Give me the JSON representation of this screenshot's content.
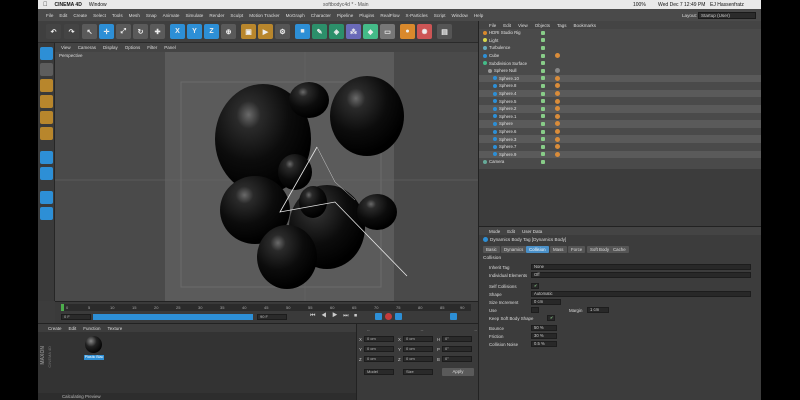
{
  "mac_menubar": {
    "apple": "",
    "app": "CINEMA 4D",
    "window": "Window",
    "clock": "Wed Dec 7  12:49 PM",
    "user": "EJ Hassenfratz",
    "battery": "100%"
  },
  "window_title": "softbodyc4d * - Main",
  "layout": {
    "label": "Layout:",
    "value": "Startup (User)"
  },
  "menu": [
    "File",
    "Edit",
    "Create",
    "Select",
    "Tools",
    "Mesh",
    "Snap",
    "Animate",
    "Simulate",
    "Render",
    "Sculpt",
    "Motion Tracker",
    "MoGraph",
    "Character",
    "Pipeline",
    "Plugins",
    "RealFlow",
    "X-Particles",
    "Script",
    "Window",
    "Help"
  ],
  "toolbar": {
    "axes": [
      "X",
      "Y",
      "Z"
    ]
  },
  "viewport": {
    "menus": [
      "View",
      "Cameras",
      "Display",
      "Options",
      "Filter",
      "Panel"
    ],
    "label": "Perspective"
  },
  "timeline": {
    "ticks": [
      "0",
      "5",
      "10",
      "15",
      "20",
      "25",
      "30",
      "35",
      "40",
      "45",
      "50",
      "55",
      "60",
      "65",
      "70",
      "75",
      "80",
      "85",
      "90"
    ],
    "current": "0 F",
    "start": "0 F",
    "end": "90 F",
    "max": "90 F"
  },
  "material_manager": {
    "menus": [
      "Create",
      "Edit",
      "Function",
      "Texture"
    ],
    "material_name": "Plastic Blac",
    "status": "Calculating Preview",
    "brand_line1": "MAXON",
    "brand_line2": "CINEMA 4D"
  },
  "coordinates": {
    "headers": [
      "--",
      "--",
      "--"
    ],
    "rows": [
      {
        "axis": "X",
        "pos": "0 cm",
        "axis2": "X",
        "size": "0 cm",
        "axis3": "H",
        "rot": "0°"
      },
      {
        "axis": "Y",
        "pos": "0 cm",
        "axis2": "Y",
        "size": "0 cm",
        "axis3": "P",
        "rot": "0°"
      },
      {
        "axis": "Z",
        "pos": "0 cm",
        "axis2": "Z",
        "size": "0 cm",
        "axis3": "B",
        "rot": "0°"
      }
    ],
    "mode1": "Model",
    "mode2": "Size",
    "apply": "Apply"
  },
  "object_manager": {
    "menus": [
      "File",
      "Edit",
      "View",
      "Objects",
      "Tags",
      "Bookmarks"
    ],
    "objects": [
      {
        "name": "HDRI Studio Rig",
        "indent": 0
      },
      {
        "name": "Light",
        "indent": 0
      },
      {
        "name": "Turbulence",
        "indent": 0
      },
      {
        "name": "Cube",
        "indent": 0
      },
      {
        "name": "Subdivision Surface",
        "indent": 0
      },
      {
        "name": "Sphere Null",
        "indent": 1
      },
      {
        "name": "Sphere.10",
        "indent": 2
      },
      {
        "name": "Sphere.8",
        "indent": 2
      },
      {
        "name": "Sphere.4",
        "indent": 2
      },
      {
        "name": "Sphere.5",
        "indent": 2
      },
      {
        "name": "Sphere.2",
        "indent": 2
      },
      {
        "name": "Sphere.1",
        "indent": 2
      },
      {
        "name": "Sphere",
        "indent": 2
      },
      {
        "name": "Sphere.6",
        "indent": 2
      },
      {
        "name": "Sphere.3",
        "indent": 2
      },
      {
        "name": "Sphere.7",
        "indent": 2
      },
      {
        "name": "Sphere.9",
        "indent": 2
      },
      {
        "name": "Camera",
        "indent": 0
      }
    ]
  },
  "attribute_manager": {
    "menus": [
      "Mode",
      "Edit",
      "User Data"
    ],
    "title": "Dynamics Body Tag [Dynamics Body]",
    "tabs": [
      "Basic",
      "Dynamics",
      "Collision",
      "Mass",
      "Force",
      "Soft Body",
      "Cache"
    ],
    "active_tab": "Collision",
    "section": "Collision",
    "fields": {
      "inherit_tag": {
        "label": "Inherit Tag",
        "value": "None"
      },
      "individual": {
        "label": "Individual Elements",
        "value": "Off"
      },
      "self_collisions": {
        "label": "Self Collisions",
        "value": "✔"
      },
      "shape": {
        "label": "Shape",
        "value": "Automatic"
      },
      "size_increment": {
        "label": "Size Increment",
        "value": "0 cm"
      },
      "use": {
        "label": "Use",
        "value": ""
      },
      "margin": {
        "label": "Margin",
        "value": "1 cm"
      },
      "keep_soft": {
        "label": "Keep Soft Body Shape",
        "value": "✔"
      },
      "bounce": {
        "label": "Bounce",
        "value": "50 %"
      },
      "friction": {
        "label": "Friction",
        "value": "30 %"
      },
      "collision_noise": {
        "label": "Collision Noise",
        "value": "0.5 %"
      }
    }
  },
  "colors": {
    "accent": "#2d8fd6",
    "active_tab": "#4a90c8",
    "orange": "#d9892c"
  }
}
